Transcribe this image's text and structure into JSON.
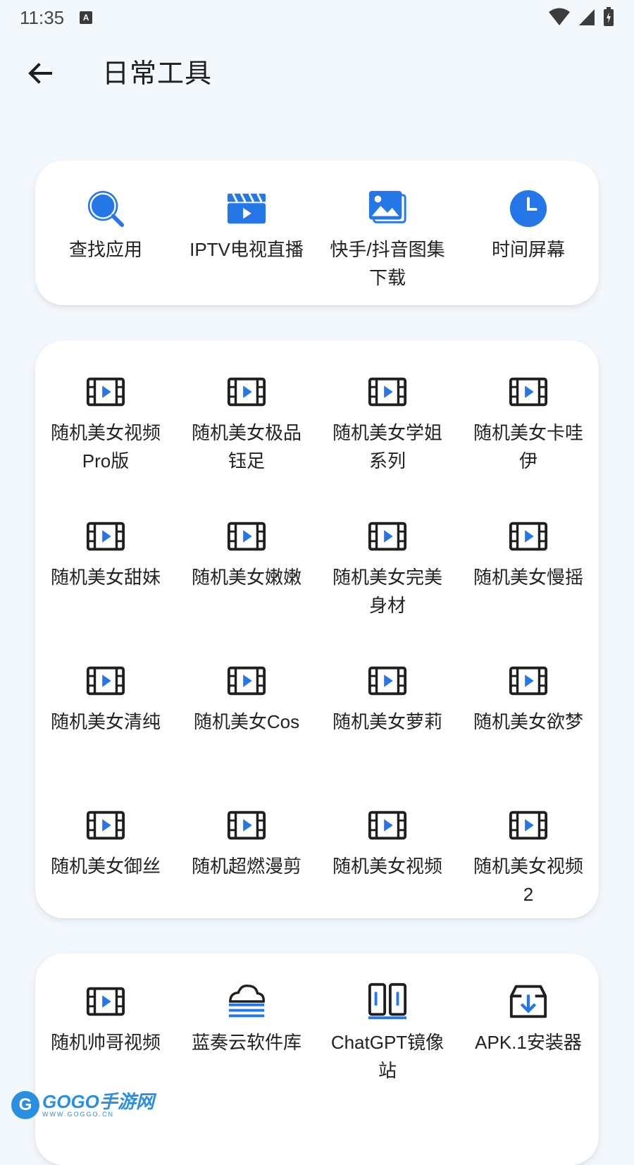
{
  "status": {
    "time": "11:35",
    "notif_glyph": "A"
  },
  "header": {
    "title": "日常工具",
    "back_icon": "arrow-left-icon"
  },
  "colors": {
    "accent": "#2577e8",
    "icon_dark": "#1f1f1f",
    "background": "#f3f8fd"
  },
  "sections": [
    {
      "items": [
        {
          "label": "查找应用",
          "icon": "search-icon"
        },
        {
          "label": "IPTV电视直播",
          "icon": "video-clapper-icon"
        },
        {
          "label": "快手/抖音图集下载",
          "icon": "image-gallery-icon"
        },
        {
          "label": "时间屏幕",
          "icon": "clock-icon"
        }
      ]
    },
    {
      "items": [
        {
          "label": "随机美女视频Pro版",
          "icon": "film-play-icon"
        },
        {
          "label": "随机美女极品钰足",
          "icon": "film-play-icon"
        },
        {
          "label": "随机美女学姐系列",
          "icon": "film-play-icon"
        },
        {
          "label": "随机美女卡哇伊",
          "icon": "film-play-icon"
        },
        {
          "label": "随机美女甜妹",
          "icon": "film-play-icon"
        },
        {
          "label": "随机美女嫩嫩",
          "icon": "film-play-icon"
        },
        {
          "label": "随机美女完美身材",
          "icon": "film-play-icon"
        },
        {
          "label": "随机美女慢摇",
          "icon": "film-play-icon"
        },
        {
          "label": "随机美女清纯",
          "icon": "film-play-icon"
        },
        {
          "label": "随机美女Cos",
          "icon": "film-play-icon"
        },
        {
          "label": "随机美女萝莉",
          "icon": "film-play-icon"
        },
        {
          "label": "随机美女欲梦",
          "icon": "film-play-icon"
        },
        {
          "label": "随机美女御丝",
          "icon": "film-play-icon"
        },
        {
          "label": "随机超燃漫剪",
          "icon": "film-play-icon"
        },
        {
          "label": "随机美女视频",
          "icon": "film-play-icon"
        },
        {
          "label": "随机美女视频2",
          "icon": "film-play-icon"
        }
      ]
    },
    {
      "items": [
        {
          "label": "随机帅哥视频",
          "icon": "film-play-icon"
        },
        {
          "label": "蓝奏云软件库",
          "icon": "cloud-layers-icon"
        },
        {
          "label": "ChatGPT镜像站",
          "icon": "mirror-panels-icon"
        },
        {
          "label": "APK.1安装器",
          "icon": "box-download-icon"
        }
      ]
    }
  ],
  "watermark": {
    "title": "GOGO手游网",
    "subtitle": "WWW.GOGGO.CN",
    "glyph": "G"
  }
}
